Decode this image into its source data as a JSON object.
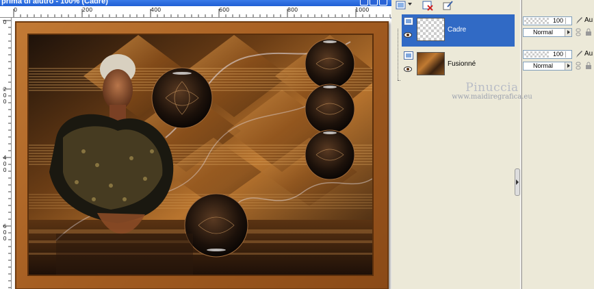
{
  "window": {
    "title": "prima di aiutro - 100% (Cadre)"
  },
  "ruler": {
    "top_labels": [
      "0",
      "200",
      "400",
      "600",
      "800",
      "1000"
    ],
    "left_labels": [
      "0",
      "200",
      "400",
      "600"
    ]
  },
  "toolbar": {
    "icons": [
      "layer-type-icon",
      "delete-layer-icon",
      "edit-layer-icon"
    ]
  },
  "layers": [
    {
      "name": "Cadre",
      "selected": true,
      "thumb": "transparent"
    },
    {
      "name": "Fusionné",
      "selected": false,
      "thumb": "photo"
    }
  ],
  "layer_props": [
    {
      "opacity": "100",
      "blend_mode": "Normal",
      "aux": "Au"
    },
    {
      "opacity": "100",
      "blend_mode": "Normal",
      "aux": "Au"
    }
  ],
  "watermark": {
    "name": "Pinuccia",
    "url": "www.maidiregrafica.eu"
  },
  "colors": {
    "selection": "#316ac5",
    "frame": "#a55e22",
    "title_bar": "#2a63d6"
  }
}
